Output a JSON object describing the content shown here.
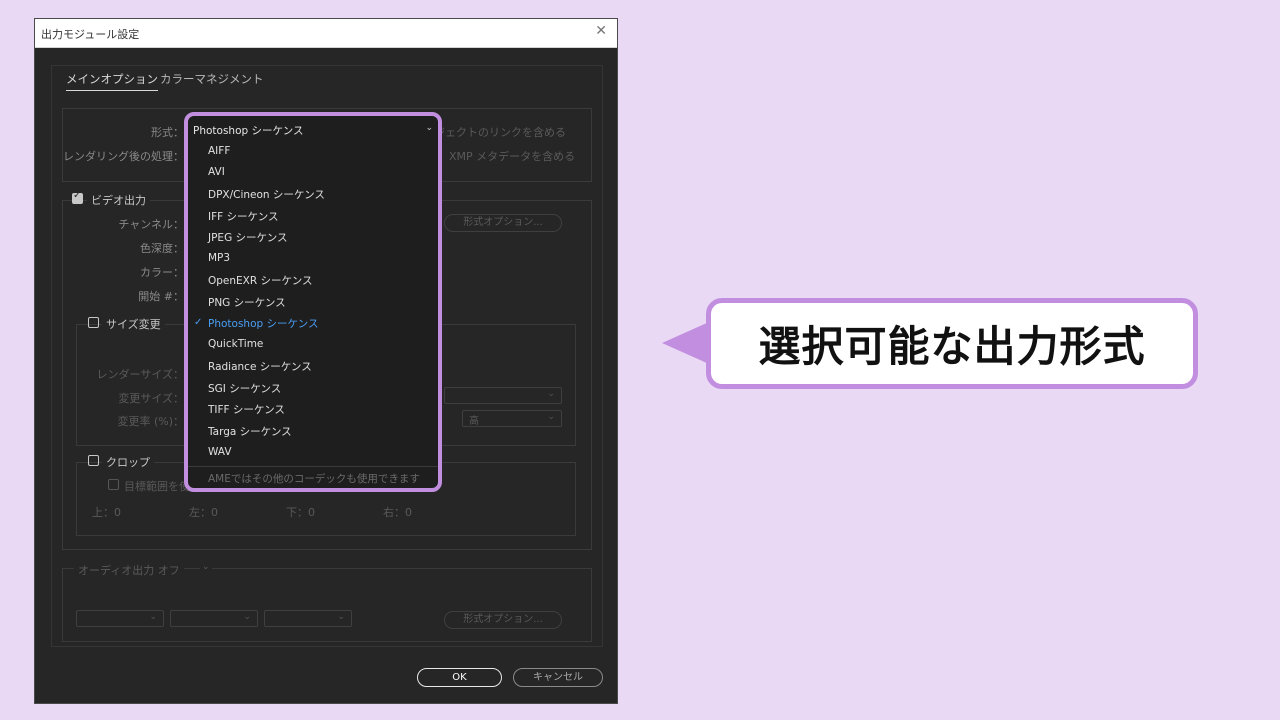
{
  "dialog": {
    "title": "出力モジュール設定",
    "tabs": [
      "メインオプション",
      "カラーマネジメント"
    ],
    "format_label": "形式：",
    "post_render_label": "レンダリング後の処理：",
    "include_project_link": "プロジェクトのリンクを含める",
    "include_xmp": "XMP メタデータを含める",
    "video_output": "ビデオ出力",
    "channel_label": "チャンネル：",
    "depth_label": "色深度：",
    "color_label": "カラー：",
    "start_label": "開始 #：",
    "format_options_label": "形式オプション...",
    "resize": "サイズ変更",
    "render_size_label": "レンダーサイズ：",
    "resize_to_label": "変更サイズ：",
    "resize_pct_label": "変更率 (%)：",
    "quality_value": "高",
    "crop": "クロップ",
    "use_roi": "目標範囲を使用",
    "crop_top": "上：0",
    "crop_left": "左：0",
    "crop_bottom": "下：0",
    "crop_right": "右：0",
    "audio_output": "オーディオ出力 オフ",
    "audio_format_options": "形式オプション...",
    "ok": "OK",
    "cancel": "キャンセル"
  },
  "format_dropdown": {
    "current": "Photoshop シーケンス",
    "options": [
      "AIFF",
      "AVI",
      "DPX/Cineon シーケンス",
      "IFF シーケンス",
      "JPEG シーケンス",
      "MP3",
      "OpenEXR シーケンス",
      "PNG シーケンス",
      "Photoshop シーケンス",
      "QuickTime",
      "Radiance シーケンス",
      "SGI シーケンス",
      "TIFF シーケンス",
      "Targa シーケンス",
      "WAV"
    ],
    "selected_index": 8,
    "footer": "AMEではその他のコーデックも使用できます"
  },
  "callout": {
    "text": "選択可能な出力形式"
  },
  "colors": {
    "accent": "#c28fe0",
    "background": "#ead9f4",
    "selected_item": "#4a9ff5"
  }
}
